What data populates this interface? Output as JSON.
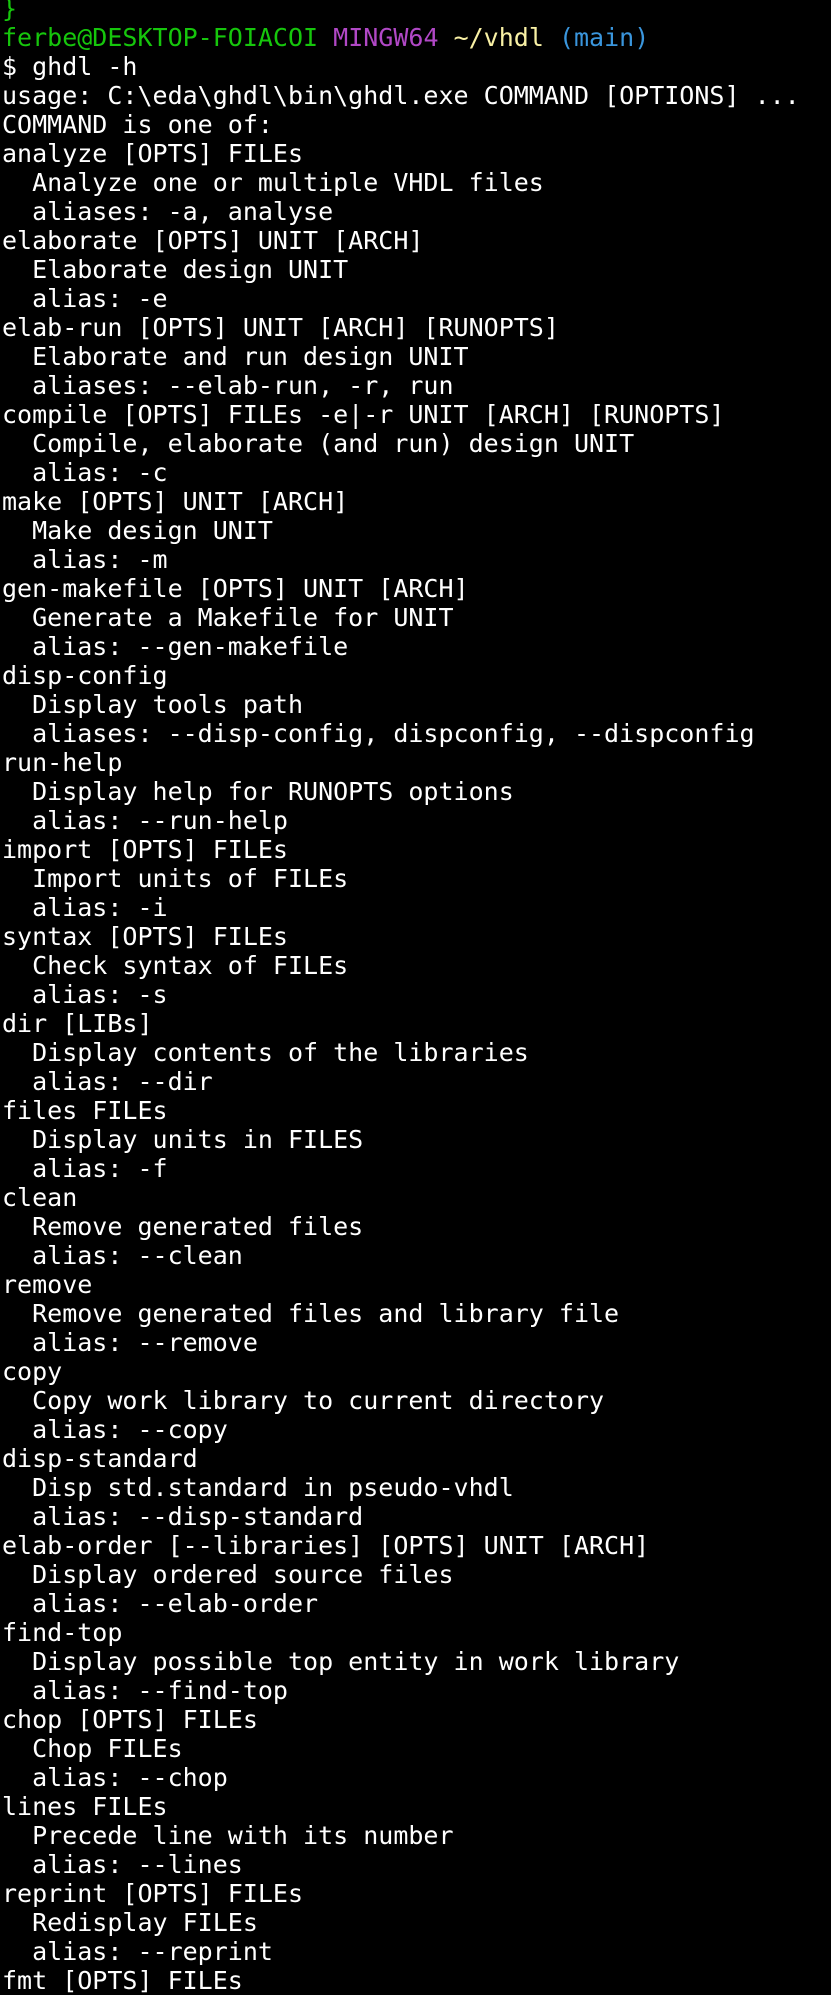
{
  "colors": {
    "background": "#000000",
    "foreground": "#ffffff",
    "prompt_user": "#16c60c",
    "prompt_system": "#b148c6",
    "prompt_path": "#f9f1a5",
    "prompt_branch": "#3a96dd"
  },
  "terminal": {
    "lines": [
      {
        "segments": [
          {
            "text": "}",
            "color": "#16c60c"
          }
        ]
      },
      {
        "segments": [
          {
            "text": "ferbe@DESKTOP-FOIACOI",
            "color": "#16c60c"
          },
          {
            "text": " "
          },
          {
            "text": "MINGW64",
            "color": "#b148c6"
          },
          {
            "text": " "
          },
          {
            "text": "~/vhdl",
            "color": "#f9f1a5"
          },
          {
            "text": " "
          },
          {
            "text": "(main)",
            "color": "#3a96dd"
          }
        ]
      },
      {
        "segments": [
          {
            "text": "$ ghdl -h"
          }
        ]
      },
      {
        "segments": [
          {
            "text": "usage: C:\\eda\\ghdl\\bin\\ghdl.exe COMMAND [OPTIONS] ..."
          }
        ]
      },
      {
        "segments": [
          {
            "text": "COMMAND is one of:"
          }
        ]
      },
      {
        "segments": [
          {
            "text": "analyze [OPTS] FILEs"
          }
        ]
      },
      {
        "segments": [
          {
            "text": "  Analyze one or multiple VHDL files"
          }
        ]
      },
      {
        "segments": [
          {
            "text": "  aliases: -a, analyse"
          }
        ]
      },
      {
        "segments": [
          {
            "text": "elaborate [OPTS] UNIT [ARCH]"
          }
        ]
      },
      {
        "segments": [
          {
            "text": "  Elaborate design UNIT"
          }
        ]
      },
      {
        "segments": [
          {
            "text": "  alias: -e"
          }
        ]
      },
      {
        "segments": [
          {
            "text": "elab-run [OPTS] UNIT [ARCH] [RUNOPTS]"
          }
        ]
      },
      {
        "segments": [
          {
            "text": "  Elaborate and run design UNIT"
          }
        ]
      },
      {
        "segments": [
          {
            "text": "  aliases: --elab-run, -r, run"
          }
        ]
      },
      {
        "segments": [
          {
            "text": "compile [OPTS] FILEs -e|-r UNIT [ARCH] [RUNOPTS]"
          }
        ]
      },
      {
        "segments": [
          {
            "text": "  Compile, elaborate (and run) design UNIT"
          }
        ]
      },
      {
        "segments": [
          {
            "text": "  alias: -c"
          }
        ]
      },
      {
        "segments": [
          {
            "text": "make [OPTS] UNIT [ARCH]"
          }
        ]
      },
      {
        "segments": [
          {
            "text": "  Make design UNIT"
          }
        ]
      },
      {
        "segments": [
          {
            "text": "  alias: -m"
          }
        ]
      },
      {
        "segments": [
          {
            "text": "gen-makefile [OPTS] UNIT [ARCH]"
          }
        ]
      },
      {
        "segments": [
          {
            "text": "  Generate a Makefile for UNIT"
          }
        ]
      },
      {
        "segments": [
          {
            "text": "  alias: --gen-makefile"
          }
        ]
      },
      {
        "segments": [
          {
            "text": "disp-config"
          }
        ]
      },
      {
        "segments": [
          {
            "text": "  Display tools path"
          }
        ]
      },
      {
        "segments": [
          {
            "text": "  aliases: --disp-config, dispconfig, --dispconfig"
          }
        ]
      },
      {
        "segments": [
          {
            "text": "run-help"
          }
        ]
      },
      {
        "segments": [
          {
            "text": "  Display help for RUNOPTS options"
          }
        ]
      },
      {
        "segments": [
          {
            "text": "  alias: --run-help"
          }
        ]
      },
      {
        "segments": [
          {
            "text": "import [OPTS] FILEs"
          }
        ]
      },
      {
        "segments": [
          {
            "text": "  Import units of FILEs"
          }
        ]
      },
      {
        "segments": [
          {
            "text": "  alias: -i"
          }
        ]
      },
      {
        "segments": [
          {
            "text": "syntax [OPTS] FILEs"
          }
        ]
      },
      {
        "segments": [
          {
            "text": "  Check syntax of FILEs"
          }
        ]
      },
      {
        "segments": [
          {
            "text": "  alias: -s"
          }
        ]
      },
      {
        "segments": [
          {
            "text": "dir [LIBs]"
          }
        ]
      },
      {
        "segments": [
          {
            "text": "  Display contents of the libraries"
          }
        ]
      },
      {
        "segments": [
          {
            "text": "  alias: --dir"
          }
        ]
      },
      {
        "segments": [
          {
            "text": "files FILEs"
          }
        ]
      },
      {
        "segments": [
          {
            "text": "  Display units in FILES"
          }
        ]
      },
      {
        "segments": [
          {
            "text": "  alias: -f"
          }
        ]
      },
      {
        "segments": [
          {
            "text": "clean"
          }
        ]
      },
      {
        "segments": [
          {
            "text": "  Remove generated files"
          }
        ]
      },
      {
        "segments": [
          {
            "text": "  alias: --clean"
          }
        ]
      },
      {
        "segments": [
          {
            "text": "remove"
          }
        ]
      },
      {
        "segments": [
          {
            "text": "  Remove generated files and library file"
          }
        ]
      },
      {
        "segments": [
          {
            "text": "  alias: --remove"
          }
        ]
      },
      {
        "segments": [
          {
            "text": "copy"
          }
        ]
      },
      {
        "segments": [
          {
            "text": "  Copy work library to current directory"
          }
        ]
      },
      {
        "segments": [
          {
            "text": "  alias: --copy"
          }
        ]
      },
      {
        "segments": [
          {
            "text": "disp-standard"
          }
        ]
      },
      {
        "segments": [
          {
            "text": "  Disp std.standard in pseudo-vhdl"
          }
        ]
      },
      {
        "segments": [
          {
            "text": "  alias: --disp-standard"
          }
        ]
      },
      {
        "segments": [
          {
            "text": "elab-order [--libraries] [OPTS] UNIT [ARCH]"
          }
        ]
      },
      {
        "segments": [
          {
            "text": "  Display ordered source files"
          }
        ]
      },
      {
        "segments": [
          {
            "text": "  alias: --elab-order"
          }
        ]
      },
      {
        "segments": [
          {
            "text": "find-top"
          }
        ]
      },
      {
        "segments": [
          {
            "text": "  Display possible top entity in work library"
          }
        ]
      },
      {
        "segments": [
          {
            "text": "  alias: --find-top"
          }
        ]
      },
      {
        "segments": [
          {
            "text": "chop [OPTS] FILEs"
          }
        ]
      },
      {
        "segments": [
          {
            "text": "  Chop FILEs"
          }
        ]
      },
      {
        "segments": [
          {
            "text": "  alias: --chop"
          }
        ]
      },
      {
        "segments": [
          {
            "text": "lines FILEs"
          }
        ]
      },
      {
        "segments": [
          {
            "text": "  Precede line with its number"
          }
        ]
      },
      {
        "segments": [
          {
            "text": "  alias: --lines"
          }
        ]
      },
      {
        "segments": [
          {
            "text": "reprint [OPTS] FILEs"
          }
        ]
      },
      {
        "segments": [
          {
            "text": "  Redisplay FILEs"
          }
        ]
      },
      {
        "segments": [
          {
            "text": "  alias: --reprint"
          }
        ]
      },
      {
        "segments": [
          {
            "text": "fmt [OPTS] FILEs"
          }
        ]
      }
    ]
  }
}
